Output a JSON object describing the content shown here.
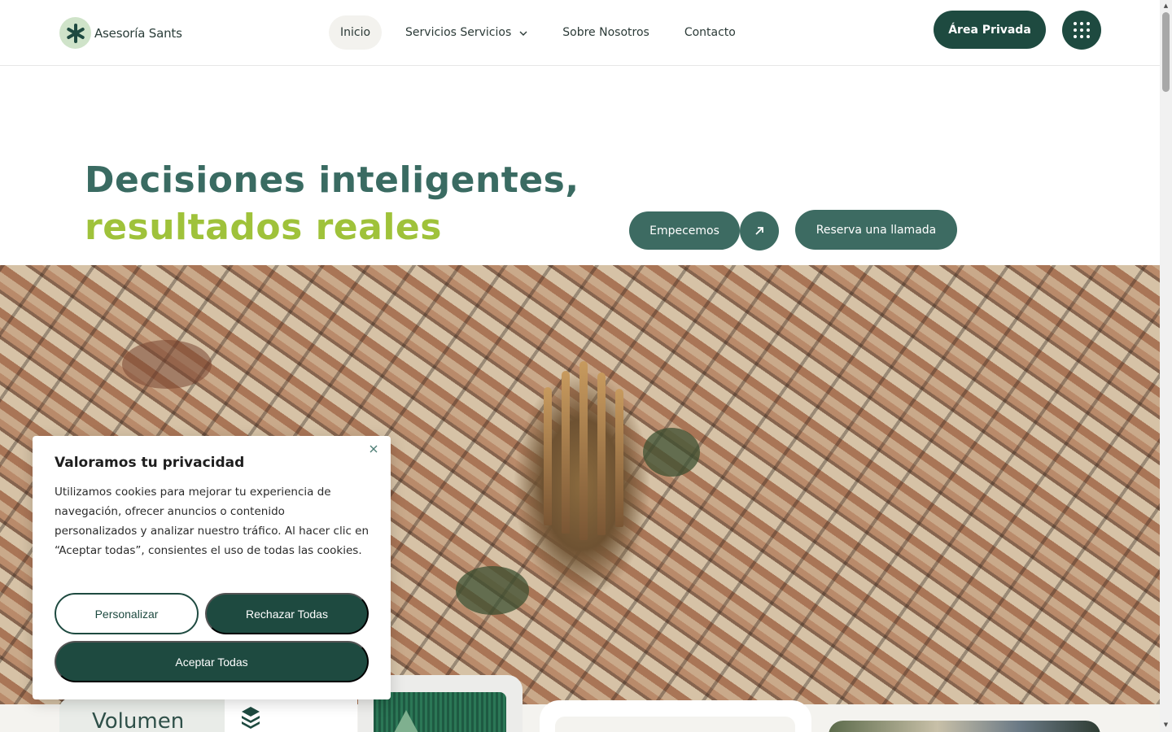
{
  "header": {
    "logo_text": "Asesoría Sants",
    "nav": [
      {
        "label": "Inicio",
        "active": true
      },
      {
        "label": "Servicios Servicios",
        "has_dropdown": true
      },
      {
        "label": "Sobre Nosotros"
      },
      {
        "label": "Contacto"
      }
    ],
    "private_area_label": "Área Privada",
    "menu_icon": "grid-dots-icon"
  },
  "hero": {
    "title_line1": "Decisiones inteligentes,",
    "title_line2": "resultados reales",
    "cta_start_label": "Empecemos",
    "cta_arrow_icon": "arrow-up-right-icon",
    "cta_call_label": "Reserva una llamada",
    "image_subject": "aerial-city-sagrada-familia"
  },
  "lower": {
    "card_title": "Volumen",
    "card_icon": "layers-icon"
  },
  "cookie_banner": {
    "title": "Valoramos tu privacidad",
    "text": "Utilizamos cookies para mejorar tu experiencia de navegación, ofrecer anuncios o contenido personalizados y analizar nuestro tráfico. Al hacer clic en “Aceptar todas”, consientes el uso de todas las cookies.",
    "customize_label": "Personalizar",
    "reject_label": "Rechazar Todas",
    "accept_label": "Aceptar Todas",
    "close_icon": "close-icon"
  },
  "colors": {
    "brand_dark": "#1e4a40",
    "brand_mid": "#3d6b62",
    "accent_lime": "#9fc23a",
    "logo_bg": "#cfe3c9"
  }
}
